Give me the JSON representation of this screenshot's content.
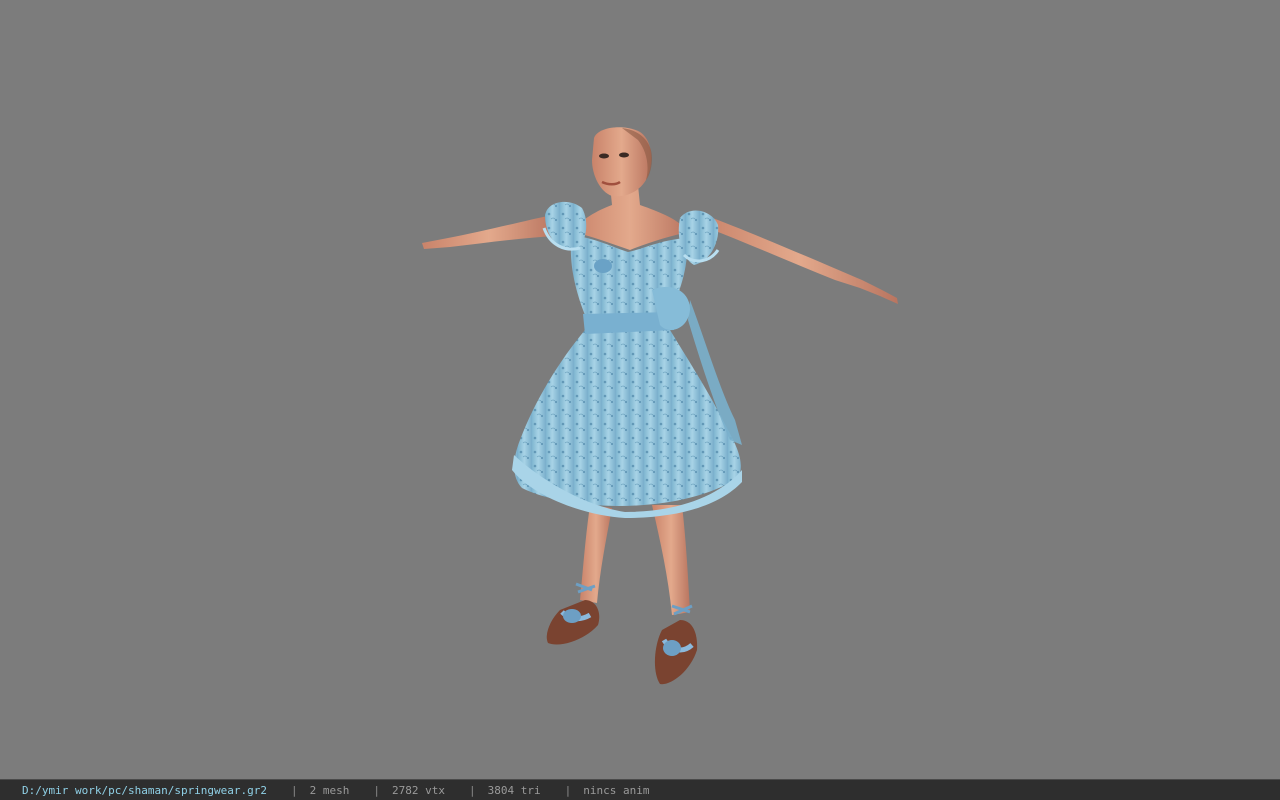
{
  "viewer": {
    "background_color": "#7c7c7c",
    "model_name": "springwear"
  },
  "status": {
    "file_path": "D:/ymir work/pc/shaman/springwear.gr2",
    "separator": "|",
    "mesh": "2 mesh",
    "vertices": "2782 vtx",
    "triangles": "3804 tri",
    "anim": "nincs anim"
  },
  "colors": {
    "statusbar_bg": "#2e2e2e",
    "path_text": "#8fd0e6",
    "stat_text": "#9a9a9a",
    "dress_blue": "#8fc3dc",
    "skin": "#d89a7e"
  }
}
